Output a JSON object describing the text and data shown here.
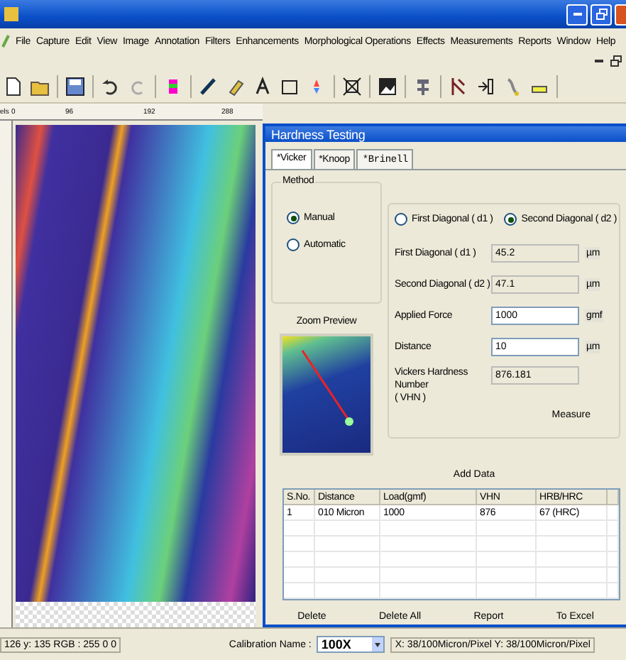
{
  "menu": [
    "File",
    "Capture",
    "Edit",
    "View",
    "Image",
    "Annotation",
    "Filters",
    "Enhancements",
    "Morphological Operations",
    "Effects",
    "Measurements",
    "Reports",
    "Window",
    "Help"
  ],
  "ruler": {
    "unit": "els",
    "ticks": [
      "0",
      "96",
      "192",
      "288"
    ]
  },
  "dialog": {
    "title": "Hardness Testing",
    "tabs": [
      {
        "label": "*Vicker",
        "selected": true
      },
      {
        "label": "*Knoop",
        "selected": false
      },
      {
        "label": "*Brinell",
        "selected": false
      }
    ],
    "method": {
      "legend": "Method",
      "options": [
        {
          "label": "Manual",
          "selected": true
        },
        {
          "label": "Automatic",
          "selected": false
        }
      ]
    },
    "zoom_preview": "Zoom Preview",
    "diagonal": [
      {
        "label": "First Diagonal ( d1 )",
        "selected": false
      },
      {
        "label": "Second Diagonal ( d2 )",
        "selected": true
      }
    ],
    "fields": [
      {
        "label": "First Diagonal ( d1 )",
        "value": "45.2",
        "unit": "µm",
        "readonly": true
      },
      {
        "label": "Second Diagonal ( d2 )",
        "value": "47.1",
        "unit": "µm",
        "readonly": true
      },
      {
        "label": "Applied Force",
        "value": "1000",
        "unit": "gmf",
        "readonly": false
      },
      {
        "label": "Distance",
        "value": "10",
        "unit": "µm",
        "readonly": false
      },
      {
        "label": "Vickers Hardness Number\n( VHN )",
        "value": "876.181",
        "readonly": true
      }
    ],
    "measure": "Measure",
    "add_data": "Add Data",
    "table": {
      "columns": [
        "S.No.",
        "Distance",
        "Load(gmf)",
        "VHN",
        "HRB/HRC"
      ],
      "rows": [
        [
          "1",
          "010 Micron",
          "1000",
          "876",
          "67 (HRC)"
        ]
      ]
    },
    "buttons": [
      "Delete",
      "Delete All",
      "Report",
      "To Excel"
    ]
  },
  "status_bar": {
    "pixel": "126 y: 135 RGB : 255 0 0",
    "calibration_label": "Calibration Name :",
    "calibration": "100X",
    "scale": "X: 38/100Micron/Pixel Y: 38/100Micron/Pixel"
  }
}
